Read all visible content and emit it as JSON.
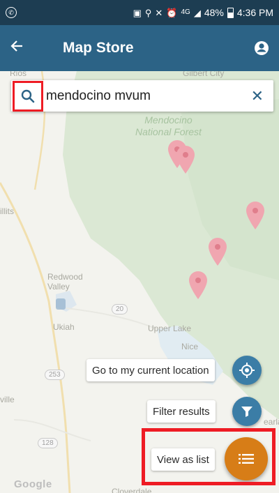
{
  "status_bar": {
    "left_icon": "whatsapp-icon",
    "icons": [
      "sim-icon",
      "location-icon",
      "mute-icon",
      "alarm-icon",
      "4g-icon",
      "signal-icon"
    ],
    "network": "4G",
    "battery": "48%",
    "time": "4:36 PM"
  },
  "app_bar": {
    "title": "Map Store",
    "back_icon": "arrow-left-icon",
    "account_icon": "account-circle-icon",
    "color": "#2c6386"
  },
  "search": {
    "query": "mendocino mvum",
    "search_icon": "search-icon",
    "clear_icon": "close-icon"
  },
  "map": {
    "labels": {
      "city_top": "Gilbert City",
      "rios": "Rios",
      "forest_line1": "Mendocino",
      "forest_line2": "National Forest",
      "willits": "illits",
      "redwood1": "Redwood",
      "redwood2": "Valley",
      "ukiah": "Ukiah",
      "upper_lake": "Upper Lake",
      "nice": "Nice",
      "lakeport": "ville",
      "clearlake": "earla",
      "cloverdale": "Cloverdale"
    },
    "shields": [
      "20",
      "253",
      "128"
    ],
    "attribution": "Google"
  },
  "fab_menu": {
    "current_location_label": "Go to my current location",
    "filter_label": "Filter results",
    "list_label": "View as list",
    "accent_color": "#d77d17"
  }
}
